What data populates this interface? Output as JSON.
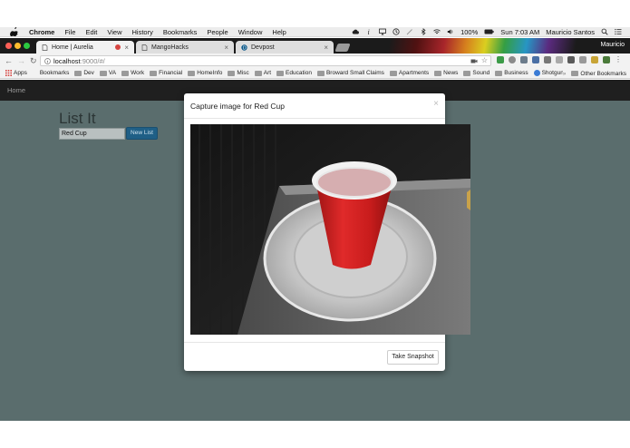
{
  "menubar": {
    "app_name": "Chrome",
    "menus": [
      "File",
      "Edit",
      "View",
      "History",
      "Bookmarks",
      "People",
      "Window",
      "Help"
    ],
    "battery": "100%",
    "clock": "Sun 7:03 AM",
    "user": "Mauricio Santos"
  },
  "tabs": [
    {
      "title": "Home | Aurelia",
      "active": true
    },
    {
      "title": "MangoHacks",
      "active": false
    },
    {
      "title": "Devpost",
      "active": false
    }
  ],
  "profile_name": "Mauricio",
  "address": {
    "host": "localhost",
    "path": ":9000/#/"
  },
  "bookmarks": {
    "apps_label": "Apps",
    "items": [
      "Bookmarks",
      "Dev",
      "VA",
      "Work",
      "Financial",
      "HomeInfo",
      "Misc",
      "Art",
      "Education",
      "Broward Small Claims",
      "Apartments",
      "News",
      "Sound",
      "Business",
      "Shotgun"
    ],
    "other": "Other Bookmarks"
  },
  "page": {
    "nav_home": "Home",
    "title": "List It",
    "input_value": "Red Cup",
    "new_list_button": "New List"
  },
  "modal": {
    "title": "Capture image for Red Cup",
    "close_glyph": "×",
    "take_snapshot_button": "Take Snapshot"
  },
  "colors": {
    "page_bg": "#5a6d6d",
    "navbar_bg": "#1f1f1f",
    "primary_button": "#1f5f86",
    "cup_red": "#d01f1f"
  }
}
